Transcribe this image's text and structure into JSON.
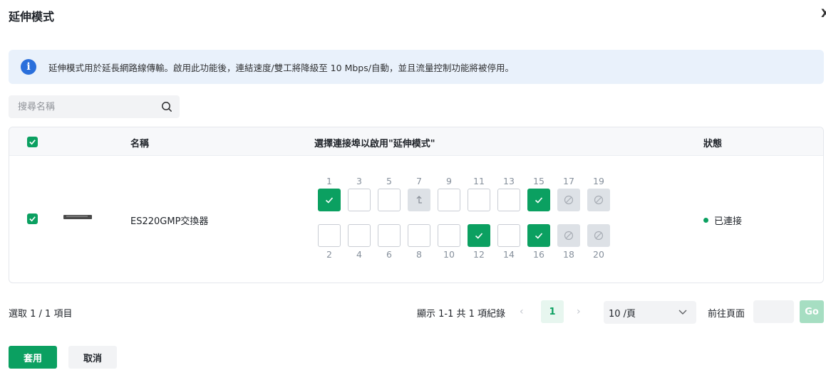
{
  "dialog": {
    "title": "延伸模式",
    "close_label": "X"
  },
  "info": {
    "icon": "info-icon",
    "text": "延伸模式用於延長網路線傳輸。啟用此功能後，連結速度/雙工將降級至 10 Mbps/自動，並且流量控制功能將被停用。"
  },
  "search": {
    "placeholder": "搜尋名稱",
    "value": ""
  },
  "table": {
    "headers": {
      "name": "名稱",
      "ports": "選擇連接埠以啟用\"延伸模式\"",
      "status": "狀態"
    },
    "rows": [
      {
        "checked": true,
        "name": "ES220GMP交換器",
        "status": "已連接",
        "status_color": "#0ba061",
        "ports_top": [
          {
            "num": "1",
            "state": "checked"
          },
          {
            "num": "3",
            "state": "empty"
          },
          {
            "num": "5",
            "state": "empty"
          },
          {
            "num": "7",
            "state": "uplink"
          },
          {
            "num": "9",
            "state": "empty"
          },
          {
            "num": "11",
            "state": "empty"
          },
          {
            "num": "13",
            "state": "empty"
          },
          {
            "num": "15",
            "state": "checked"
          },
          {
            "num": "17",
            "state": "disabled"
          },
          {
            "num": "19",
            "state": "disabled"
          }
        ],
        "ports_bottom": [
          {
            "num": "2",
            "state": "empty"
          },
          {
            "num": "4",
            "state": "empty"
          },
          {
            "num": "6",
            "state": "empty"
          },
          {
            "num": "8",
            "state": "empty"
          },
          {
            "num": "10",
            "state": "empty"
          },
          {
            "num": "12",
            "state": "checked"
          },
          {
            "num": "14",
            "state": "empty"
          },
          {
            "num": "16",
            "state": "checked"
          },
          {
            "num": "18",
            "state": "disabled"
          },
          {
            "num": "20",
            "state": "disabled"
          }
        ]
      }
    ]
  },
  "footer": {
    "selected": "選取 1 / 1 項目",
    "page_info": "顯示 1-1 共 1 項紀錄",
    "prev": "‹",
    "current_page": "1",
    "next": "›",
    "page_size": "10 /頁",
    "goto_label": "前往頁面",
    "go": "Go"
  },
  "actions": {
    "apply": "套用",
    "cancel": "取消"
  },
  "colors": {
    "accent": "#0ba061",
    "info_bg": "#e9f1fb",
    "info_icon": "#2a6fdb"
  }
}
